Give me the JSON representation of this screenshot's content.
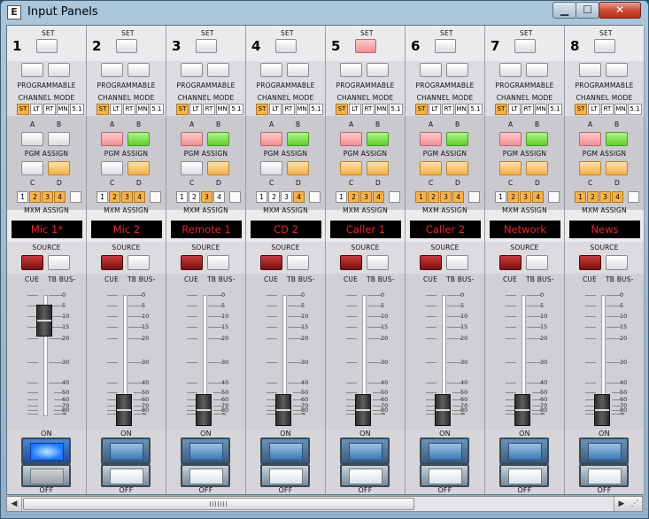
{
  "window": {
    "title": "Input Panels",
    "icon_letter": "E",
    "controls": {
      "minimize": "▁",
      "maximize": "☐",
      "close": "✕"
    }
  },
  "labels": {
    "set": "SET",
    "programmable": "PROGRAMMABLE",
    "channel_mode": "CHANNEL MODE",
    "a": "A",
    "b": "B",
    "c": "C",
    "d": "D",
    "pgm_assign": "PGM ASSIGN",
    "mxm_assign": "MXM ASSIGN",
    "source": "SOURCE",
    "cue": "CUE",
    "tb_bus": "TB BUS-",
    "on": "ON",
    "off": "OFF"
  },
  "mode_labels": [
    "ST",
    "LT",
    "RT",
    "MN",
    "5.1"
  ],
  "mxm_labels": [
    "1",
    "2",
    "3",
    "4",
    ""
  ],
  "scale": [
    "0",
    "5",
    "10",
    "15",
    "20",
    "30",
    "40",
    "50",
    "60",
    "70",
    "80",
    "∞"
  ],
  "colors": {
    "active": "#f7b24a",
    "name_text": "#e8262a",
    "on_lit": "#1f7bff"
  },
  "channels": [
    {
      "number": "1",
      "name": "Mic 1*",
      "set": "white",
      "mode_active": 0,
      "ab_top": [
        "white",
        "white"
      ],
      "ab_bottom": [
        "white",
        "orange"
      ],
      "mxm_active": [
        1,
        2,
        3
      ],
      "fader_db": 12,
      "on_lit": true
    },
    {
      "number": "2",
      "name": "Mic 2",
      "set": "white",
      "mode_active": 0,
      "ab_top": [
        "pink",
        "green"
      ],
      "ab_bottom": [
        "white",
        "orange"
      ],
      "mxm_active": [
        1,
        2,
        3
      ],
      "fader_db": 80,
      "on_lit": false
    },
    {
      "number": "3",
      "name": "Remote 1",
      "set": "white",
      "mode_active": 0,
      "ab_top": [
        "pink",
        "green"
      ],
      "ab_bottom": [
        "white",
        "orange"
      ],
      "mxm_active": [
        2
      ],
      "fader_db": 80,
      "on_lit": false
    },
    {
      "number": "4",
      "name": "CD 2",
      "set": "white",
      "mode_active": 0,
      "ab_top": [
        "pink",
        "green"
      ],
      "ab_bottom": [
        "white",
        "orange"
      ],
      "mxm_active": [
        3
      ],
      "fader_db": 80,
      "on_lit": false
    },
    {
      "number": "5",
      "name": "Caller 1",
      "set": "pink",
      "mode_active": 0,
      "ab_top": [
        "pink",
        "green"
      ],
      "ab_bottom": [
        "orange",
        "orange"
      ],
      "mxm_active": [
        1,
        2,
        3
      ],
      "fader_db": 80,
      "on_lit": false
    },
    {
      "number": "6",
      "name": "Caller 2",
      "set": "white",
      "mode_active": 0,
      "ab_top": [
        "pink",
        "green"
      ],
      "ab_bottom": [
        "orange",
        "orange"
      ],
      "mxm_active": [
        0,
        1,
        2,
        3
      ],
      "fader_db": 80,
      "on_lit": false
    },
    {
      "number": "7",
      "name": "Network",
      "set": "white",
      "mode_active": 0,
      "ab_top": [
        "pink",
        "green"
      ],
      "ab_bottom": [
        "orange",
        "orange"
      ],
      "mxm_active": [
        1,
        2,
        3
      ],
      "fader_db": 80,
      "on_lit": false
    },
    {
      "number": "8",
      "name": "News",
      "set": "white",
      "mode_active": 0,
      "ab_top": [
        "pink",
        "green"
      ],
      "ab_bottom": [
        "orange",
        "orange"
      ],
      "mxm_active": [
        0,
        1,
        2,
        3
      ],
      "fader_db": 80,
      "on_lit": false
    }
  ]
}
